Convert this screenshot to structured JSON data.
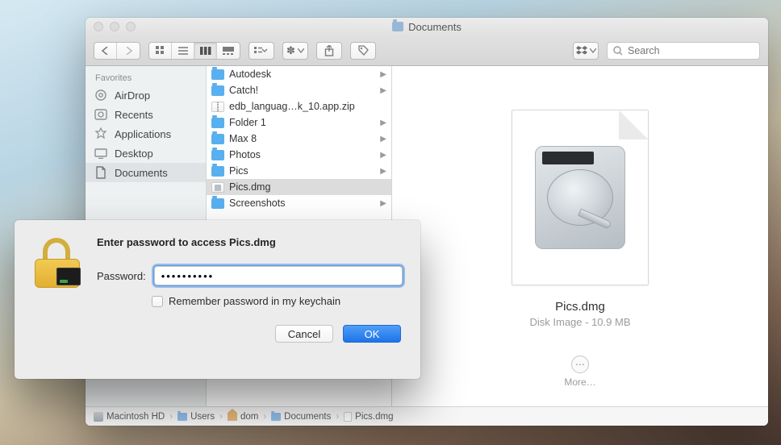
{
  "window": {
    "title": "Documents"
  },
  "toolbar": {
    "search_placeholder": "Search"
  },
  "sidebar": {
    "header": "Favorites",
    "items": [
      {
        "label": "AirDrop",
        "icon": "airdrop",
        "selected": false
      },
      {
        "label": "Recents",
        "icon": "recents",
        "selected": false
      },
      {
        "label": "Applications",
        "icon": "applications",
        "selected": false
      },
      {
        "label": "Desktop",
        "icon": "desktop",
        "selected": false
      },
      {
        "label": "Documents",
        "icon": "documents",
        "selected": true
      }
    ]
  },
  "column": {
    "items": [
      {
        "label": "Autodesk",
        "kind": "folder",
        "has_children": true
      },
      {
        "label": "Catch!",
        "kind": "folder",
        "has_children": true
      },
      {
        "label": "edb_languag…k_10.app.zip",
        "kind": "zip",
        "has_children": false
      },
      {
        "label": "Folder 1",
        "kind": "folder",
        "has_children": true
      },
      {
        "label": "Max 8",
        "kind": "folder",
        "has_children": true
      },
      {
        "label": "Photos",
        "kind": "folder",
        "has_children": true
      },
      {
        "label": "Pics",
        "kind": "folder",
        "has_children": true
      },
      {
        "label": "Pics.dmg",
        "kind": "dmg",
        "has_children": false,
        "selected": true
      },
      {
        "label": "Screenshots",
        "kind": "folder",
        "has_children": true
      }
    ]
  },
  "preview": {
    "name": "Pics.dmg",
    "kind_size": "Disk Image - 10.9 MB",
    "more_label": "More…"
  },
  "pathbar": {
    "items": [
      {
        "label": "Macintosh HD",
        "icon": "hdd"
      },
      {
        "label": "Users",
        "icon": "folder"
      },
      {
        "label": "dom",
        "icon": "home"
      },
      {
        "label": "Documents",
        "icon": "folder"
      },
      {
        "label": "Pics.dmg",
        "icon": "file"
      }
    ]
  },
  "dialog": {
    "title": "Enter password to access Pics.dmg",
    "password_label": "Password:",
    "password_value": "••••••••••",
    "remember_label": "Remember password in my keychain",
    "cancel_label": "Cancel",
    "ok_label": "OK"
  }
}
